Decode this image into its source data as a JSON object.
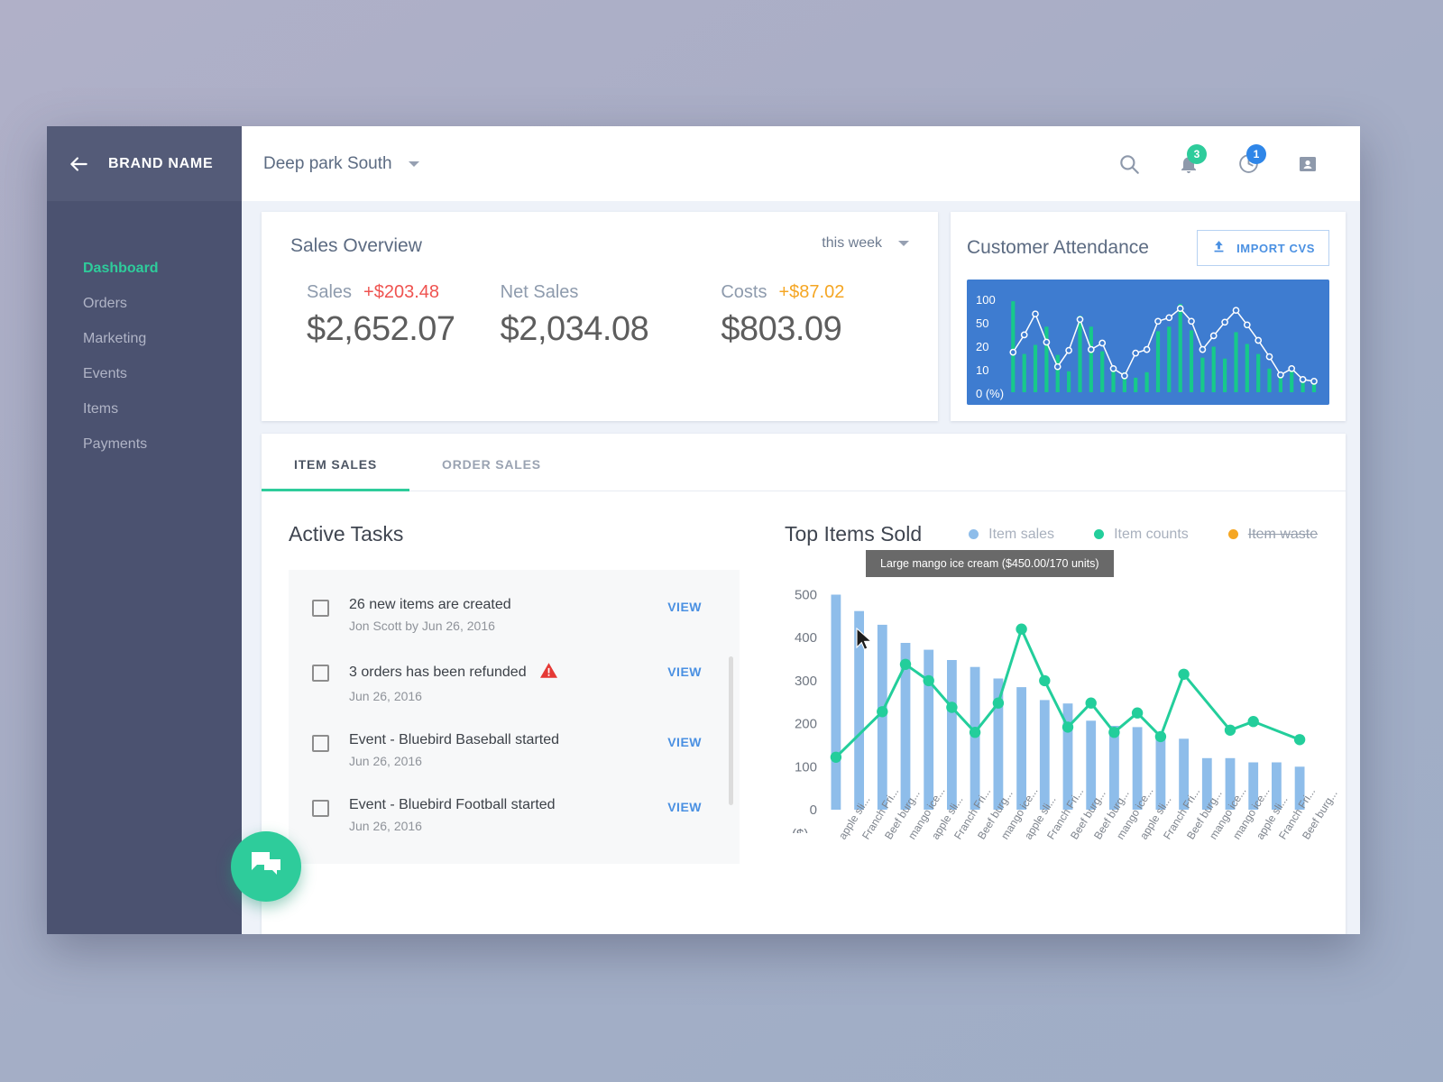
{
  "sidebar": {
    "brand": "BRAND NAME",
    "back_icon": "arrow-left-icon",
    "items": [
      {
        "label": "Dashboard",
        "active": true
      },
      {
        "label": "Orders",
        "active": false
      },
      {
        "label": "Marketing",
        "active": false
      },
      {
        "label": "Events",
        "active": false
      },
      {
        "label": "Items",
        "active": false
      },
      {
        "label": "Payments",
        "active": false
      }
    ]
  },
  "topbar": {
    "location": "Deep park South",
    "icons": [
      {
        "name": "search-icon",
        "badge": null
      },
      {
        "name": "bell-icon",
        "badge": "3",
        "badge_color": "#2ecc9b"
      },
      {
        "name": "clock-history-icon",
        "badge": "1",
        "badge_color": "#2f86e8"
      },
      {
        "name": "contact-card-icon",
        "badge": null
      }
    ]
  },
  "sales_overview": {
    "title": "Sales Overview",
    "period": "this week",
    "metrics": [
      {
        "name": "Sales",
        "delta": "+$203.48",
        "delta_color": "#ef5350",
        "value": "$2,652.07"
      },
      {
        "name": "Net Sales",
        "delta": "",
        "delta_color": "",
        "value": "$2,034.08"
      },
      {
        "name": "Costs",
        "delta": "+$87.02",
        "delta_color": "#f5a623",
        "value": "$803.09"
      }
    ]
  },
  "attendance": {
    "title": "Customer Attendance",
    "import_button": "IMPORT CVS",
    "import_icon": "upload-icon"
  },
  "tabs": [
    {
      "label": "ITEM SALES",
      "active": true
    },
    {
      "label": "ORDER SALES",
      "active": false
    }
  ],
  "tasks": {
    "title": "Active Tasks",
    "view_label": "VIEW",
    "items": [
      {
        "title": "26 new items are created",
        "sub": "Jon Scott by Jun 26, 2016",
        "warn": false
      },
      {
        "title": "3 orders has been refunded",
        "sub": "Jun 26, 2016",
        "warn": true
      },
      {
        "title": "Event - Bluebird Baseball started",
        "sub": "Jun 26, 2016",
        "warn": false
      },
      {
        "title": "Event - Bluebird Football started",
        "sub": "Jun 26, 2016",
        "warn": false
      }
    ]
  },
  "items_sold": {
    "title": "Top Items Sold",
    "tooltip": "Large mango ice cream ($450.00/170 units)",
    "legend": [
      {
        "label": "Item sales",
        "color": "#8ebdea",
        "disabled": false
      },
      {
        "label": "Item counts",
        "color": "#23ce9b",
        "disabled": false
      },
      {
        "label": "Item waste",
        "color": "#f5a623",
        "disabled": true
      }
    ]
  },
  "fab": {
    "icon": "chat-bubbles-icon",
    "color": "#2ecc9b"
  },
  "chart_data": [
    {
      "id": "customer-attendance",
      "type": "bar",
      "title": "Customer Attendance",
      "ylabel": "0 (%)",
      "ytick_labels": [
        "100",
        "50",
        "20",
        "10",
        "0 (%)"
      ],
      "ytick_positions": [
        100,
        50,
        20,
        10,
        0
      ],
      "ylim": [
        0,
        110
      ],
      "grid": false,
      "legend": "none",
      "bar_color": "#17c98a",
      "line_color": "#ffffff",
      "plot_background": "#3e7cd0",
      "series": [
        {
          "name": "bars",
          "type": "bar",
          "values": [
            100,
            42,
            52,
            72,
            41,
            23,
            84,
            72,
            45,
            28,
            22,
            16,
            22,
            67,
            72,
            97,
            68,
            38,
            50,
            37,
            66,
            53,
            42,
            26,
            17,
            23,
            15,
            11
          ]
        },
        {
          "name": "trend",
          "type": "line",
          "values": [
            44,
            63,
            86,
            55,
            28,
            46,
            80,
            47,
            54,
            26,
            18,
            43,
            47,
            78,
            82,
            92,
            78,
            47,
            62,
            77,
            90,
            74,
            57,
            39,
            19,
            26,
            14,
            12
          ]
        }
      ]
    },
    {
      "id": "top-items-sold",
      "type": "bar",
      "title": "Top Items Sold",
      "xlabel": "",
      "ylabel": "($)",
      "ytick_labels": [
        "500",
        "400",
        "300",
        "200",
        "100",
        "0",
        "($)"
      ],
      "ytick_positions": [
        500,
        400,
        300,
        200,
        100,
        0
      ],
      "ylim": [
        0,
        520
      ],
      "grid": false,
      "legend_position": "top-right",
      "categories": [
        "apple sli...",
        "Franch Fri...",
        "Beef burg...",
        "mango ice...",
        "apple sli...",
        "Franch Fri...",
        "Beef burg...",
        "mango ice...",
        "apple sli...",
        "Franch Fri...",
        "Beef burg...",
        "Beef burg...",
        "mango ice...",
        "apple sli...",
        "Franch Fri...",
        "Beef burg...",
        "mango ice...",
        "mango ice...",
        "apple sli...",
        "Franch Fri...",
        "Beef burg..."
      ],
      "series": [
        {
          "name": "Item sales",
          "type": "bar",
          "color": "#8ebdea",
          "values": [
            500,
            462,
            430,
            388,
            372,
            348,
            332,
            305,
            285,
            255,
            247,
            207,
            195,
            192,
            165,
            165,
            120,
            120,
            110,
            110,
            100
          ]
        },
        {
          "name": "Item counts",
          "type": "line",
          "color": "#23ce9b",
          "values": [
            122,
            null,
            228,
            338,
            300,
            238,
            180,
            248,
            420,
            300,
            192,
            248,
            180,
            225,
            170,
            315,
            null,
            185,
            205,
            null,
            163
          ]
        },
        {
          "name": "Item waste",
          "type": "line",
          "color": "#f5a623",
          "disabled": true,
          "values": []
        }
      ]
    }
  ]
}
